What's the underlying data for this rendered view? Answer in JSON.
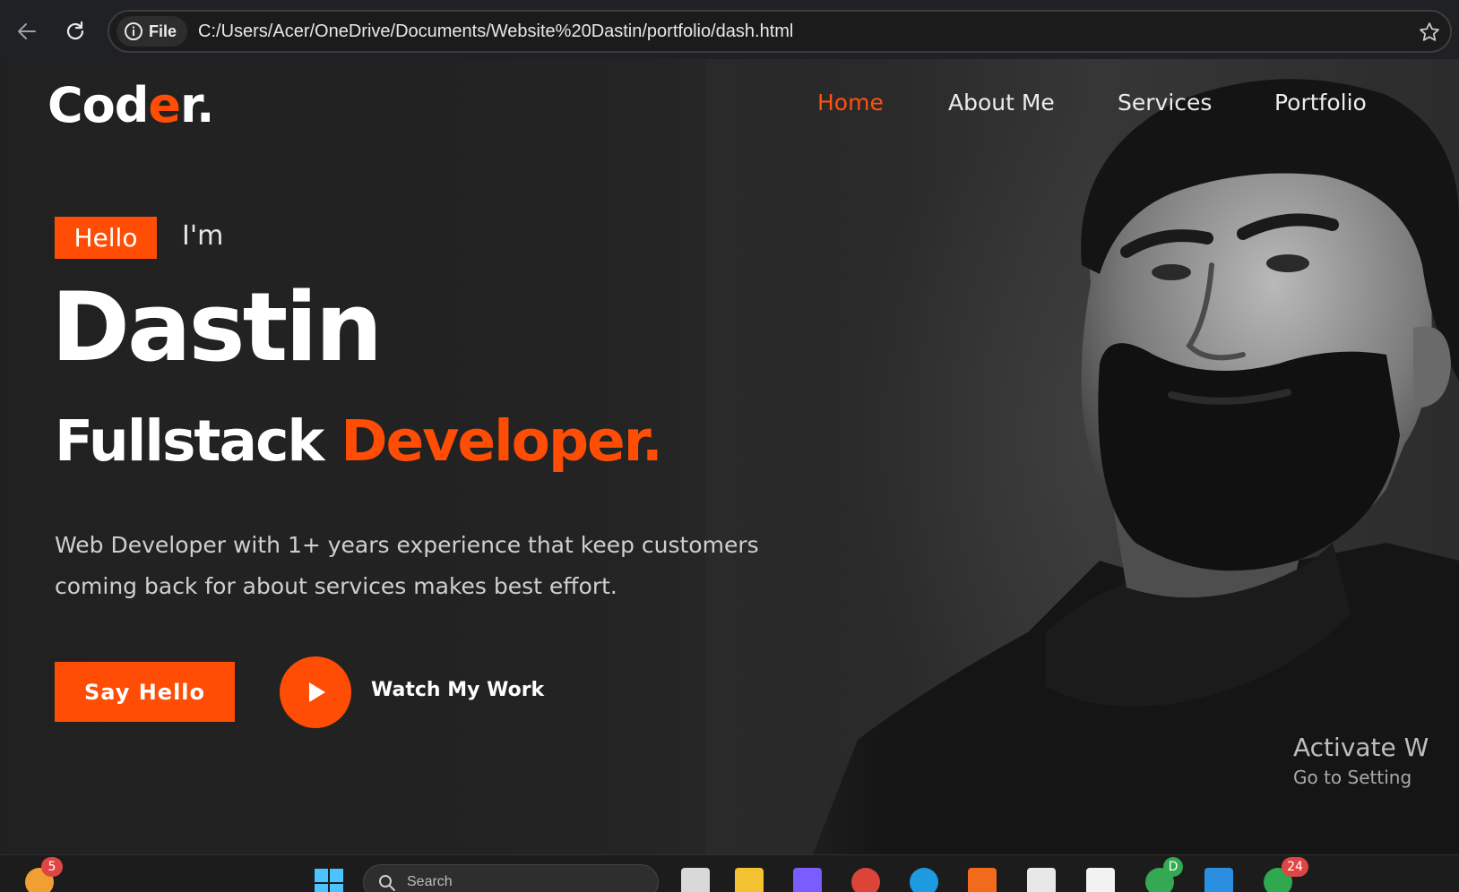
{
  "browser": {
    "site_info_label": "File",
    "url": "C:/Users/Acer/OneDrive/Documents/Website%20Dastin/portfolio/dash.html"
  },
  "site": {
    "logo": {
      "main": "Cod",
      "accent": "e",
      "tail": "r."
    },
    "nav": [
      {
        "label": "Home",
        "active": true
      },
      {
        "label": "About Me",
        "active": false
      },
      {
        "label": "Services",
        "active": false
      },
      {
        "label": "Portfolio",
        "active": false
      }
    ],
    "hero": {
      "badge": "Hello",
      "greeting": "I'm",
      "name": "Dastin",
      "role_main": "Fullstack",
      "role_accent": "Developer.",
      "description_line1": "Web Developer with 1+ years experience that keep customers",
      "description_line2": "coming back for about services makes best effort.",
      "primary_button": "Say Hello",
      "secondary_button": "Watch My Work"
    },
    "accent_color": "#ff4d05"
  },
  "watermark": {
    "title": "Activate W",
    "subtitle": "Go to Setting"
  },
  "taskbar": {
    "search_placeholder": "Search",
    "badges": {
      "weather": "5",
      "chrome_profile": "D",
      "notifications": "24"
    }
  }
}
